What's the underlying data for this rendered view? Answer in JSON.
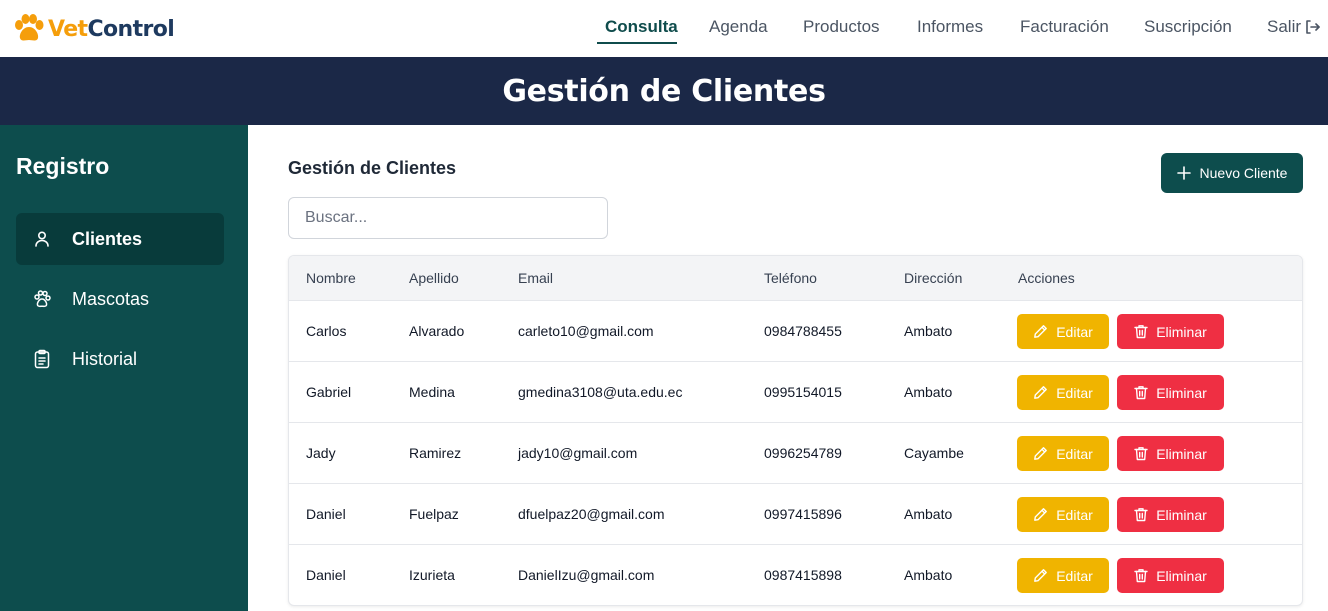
{
  "app": {
    "logo_part1": "Vet",
    "logo_part2": "Control",
    "logo_icon": "paw-icon"
  },
  "nav": {
    "items": [
      {
        "label": "Consulta",
        "active": true
      },
      {
        "label": "Agenda"
      },
      {
        "label": "Productos"
      },
      {
        "label": "Informes"
      },
      {
        "label": "Facturación"
      },
      {
        "label": "Suscripción"
      }
    ],
    "logout_label": "Salir",
    "logout_icon": "logout-icon"
  },
  "banner": {
    "title": "Gestión de Clientes"
  },
  "sidebar": {
    "title": "Registro",
    "items": [
      {
        "label": "Clientes",
        "icon": "user-icon",
        "active": true
      },
      {
        "label": "Mascotas",
        "icon": "paw-icon"
      },
      {
        "label": "Historial",
        "icon": "clipboard-icon"
      }
    ]
  },
  "main": {
    "title": "Gestión de Clientes",
    "new_button_label": "Nuevo Cliente",
    "search_placeholder": "Buscar...",
    "columns": [
      "Nombre",
      "Apellido",
      "Email",
      "Teléfono",
      "Dirección",
      "Acciones"
    ],
    "rows": [
      {
        "nombre": "Carlos",
        "apellido": "Alvarado",
        "email": "carleto10@gmail.com",
        "telefono": "0984788455",
        "direccion": "Ambato"
      },
      {
        "nombre": "Gabriel",
        "apellido": "Medina",
        "email": "gmedina3108@uta.edu.ec",
        "telefono": "0995154015",
        "direccion": "Ambato"
      },
      {
        "nombre": "Jady",
        "apellido": "Ramirez",
        "email": "jady10@gmail.com",
        "telefono": "0996254789",
        "direccion": "Cayambe"
      },
      {
        "nombre": "Daniel",
        "apellido": "Fuelpaz",
        "email": "dfuelpaz20@gmail.com",
        "telefono": "0997415896",
        "direccion": "Ambato"
      },
      {
        "nombre": "Daniel",
        "apellido": "Izurieta",
        "email": "DanielIzu@gmail.com",
        "telefono": "0987415898",
        "direccion": "Ambato"
      }
    ],
    "edit_label": "Editar",
    "delete_label": "Eliminar"
  },
  "colors": {
    "accent": "#0d4d4d",
    "banner": "#1b2847",
    "edit": "#f0b400",
    "delete": "#ef2f43",
    "logo_orange": "#f59e0b"
  }
}
